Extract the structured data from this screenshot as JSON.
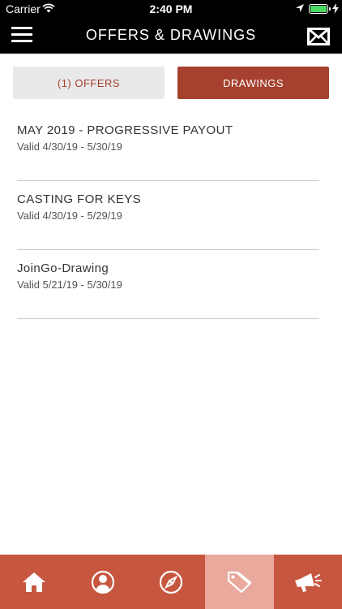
{
  "status_bar": {
    "carrier": "Carrier",
    "time": "2:40 PM"
  },
  "nav": {
    "title": "OFFERS & DRAWINGS",
    "menu_icon": "hamburger-menu-icon",
    "mail_icon": "envelope-icon"
  },
  "tabs": [
    {
      "label": "(1) OFFERS",
      "selected": false
    },
    {
      "label": "DRAWINGS",
      "selected": true
    }
  ],
  "drawings": [
    {
      "title": "MAY 2019 - PROGRESSIVE PAYOUT",
      "valid": "Valid 4/30/19 - 5/30/19"
    },
    {
      "title": "CASTING FOR KEYS",
      "valid": "Valid 4/30/19 - 5/29/19"
    },
    {
      "title": "JoinGo-Drawing",
      "valid": "Valid 5/21/19 - 5/30/19"
    }
  ],
  "tab_bar": {
    "items": [
      "home-icon",
      "profile-icon",
      "compass-icon",
      "offers-tag-icon",
      "megaphone-icon"
    ],
    "active_index": 3
  },
  "colors": {
    "brand": "#a5412e",
    "tab_bar": "#c7563f",
    "tab_bar_active": "#e9a99c",
    "header": "#000000"
  }
}
